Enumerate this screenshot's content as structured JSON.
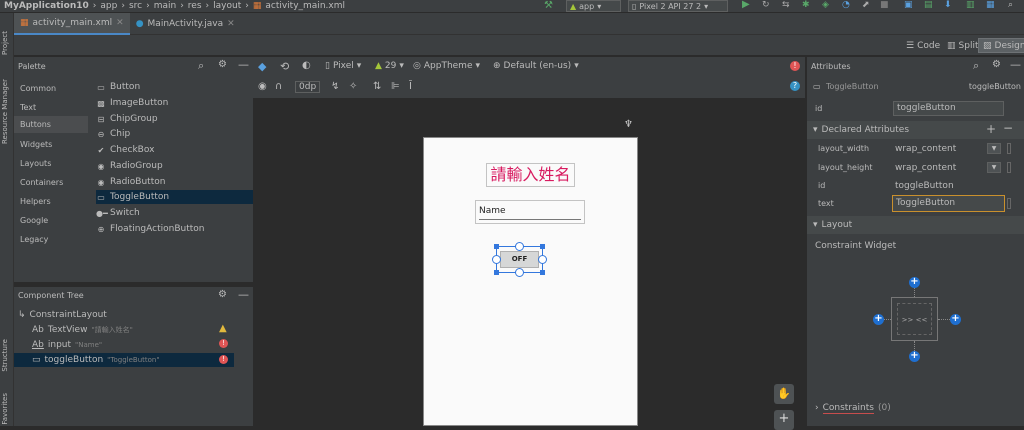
{
  "breadcrumb": {
    "items": [
      "MyApplication10",
      "app",
      "src",
      "main",
      "res",
      "layout",
      "activity_main.xml"
    ]
  },
  "toolbar": {
    "run_config": "app",
    "device": "Pixel 2 API 27 2"
  },
  "editor_tabs": [
    {
      "label": "activity_main.xml"
    },
    {
      "label": "MainActivity.java"
    }
  ],
  "left_strip": {
    "project": "Project",
    "resource_manager": "Resource Manager",
    "structure": "Structure",
    "favorites": "Favorites"
  },
  "view_modes": {
    "code": "Code",
    "split": "Split",
    "design": "Design"
  },
  "palette": {
    "title": "Palette",
    "categories": [
      "Common",
      "Text",
      "Buttons",
      "Widgets",
      "Layouts",
      "Containers",
      "Helpers",
      "Google",
      "Legacy"
    ],
    "selected_category": "Buttons",
    "items": [
      "Button",
      "ImageButton",
      "ChipGroup",
      "Chip",
      "CheckBox",
      "RadioGroup",
      "RadioButton",
      "ToggleButton",
      "Switch",
      "FloatingActionButton"
    ]
  },
  "component_tree": {
    "title": "Component Tree",
    "root": "ConstraintLayout",
    "nodes": [
      {
        "type": "Ab",
        "name": "TextView",
        "hint": "\"請輸入姓名\""
      },
      {
        "type": "Ab",
        "name": "input",
        "hint": "\"Name\""
      },
      {
        "type": "btn",
        "name": "toggleButton",
        "hint": "\"ToggleButton\""
      }
    ]
  },
  "design_toolbar": {
    "device": "Pixel",
    "api": "29",
    "theme": "AppTheme",
    "locale": "Default (en-us)",
    "margin": "0dp"
  },
  "preview": {
    "textview_text": "請輸入姓名",
    "input_text": "Name",
    "toggle_text": "OFF"
  },
  "attributes": {
    "title": "Attributes",
    "component": "ToggleButton",
    "component_id_header": "toggleButton",
    "id_label": "id",
    "id_value": "toggleButton",
    "declared_title": "Declared Attributes",
    "declared": [
      {
        "name": "layout_width",
        "value": "wrap_content"
      },
      {
        "name": "layout_height",
        "value": "wrap_content"
      },
      {
        "name": "id",
        "value": "toggleButton"
      },
      {
        "name": "text",
        "value": "ToggleButton"
      }
    ],
    "layout_title": "Layout",
    "constraint_widget": "Constraint Widget",
    "constraints_label": "Constraints",
    "constraints_count": "(0)"
  },
  "colors": {
    "accent": "#4a88c7",
    "selection": "#0d293e",
    "textview_color": "#d81b60",
    "error": "#e05555",
    "warning": "#e2b93d"
  }
}
